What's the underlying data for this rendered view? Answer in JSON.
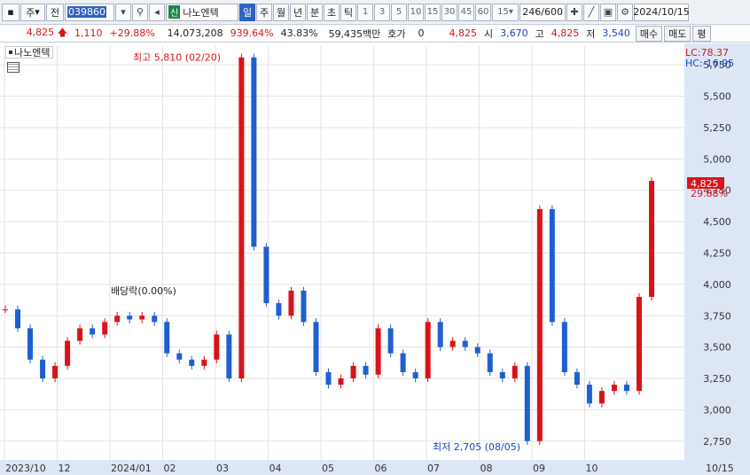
{
  "toolbar": {
    "market": "주",
    "view": "전",
    "code": "039860",
    "stock_badge": "신",
    "stock_name": "나노엔텍",
    "periods": [
      "일",
      "주",
      "월",
      "년",
      "분",
      "초",
      "틱"
    ],
    "active_period": "일",
    "intervals": [
      "1",
      "3",
      "5",
      "10",
      "15",
      "30",
      "45",
      "60"
    ],
    "interval_select": "15",
    "count": "246",
    "count_max": "/600",
    "date": "2024/10/15"
  },
  "quote": {
    "price": "4,825",
    "change": "1,110",
    "change_pct": "+29.88%",
    "volume": "14,073,208",
    "volume_ratio": "939.64%",
    "turnover": "43.83%",
    "amount": "59,435백만",
    "hoga_label": "호가",
    "hoga_value": "0",
    "hoga_price": "4,825",
    "open_label": "시",
    "open": "3,670",
    "high_label": "고",
    "high": "4,825",
    "low_label": "저",
    "low": "3,540",
    "buy_label": "매수",
    "sell_label": "매도",
    "eval_label": "평"
  },
  "legend": {
    "name": "나노엔텍"
  },
  "side": {
    "lc": "LC:78.37",
    "hc": "HC:-16.95",
    "last_price": "4,825",
    "last_pct": "29.88%"
  },
  "colors": {
    "up": "#d8141a",
    "down": "#1f5fd0",
    "axis_bg": "#dde6f4",
    "grid": "#e3e3e3"
  },
  "chart_data": {
    "type": "candlestick",
    "ylim": [
      2600,
      5900
    ],
    "y_ticks": [
      2750,
      3000,
      3250,
      3500,
      3750,
      4000,
      4250,
      4500,
      4750,
      5000,
      5250,
      5500,
      5750
    ],
    "y_tick_labels": [
      "2,750",
      "3,000",
      "3,250",
      "3,500",
      "3,750",
      "4,000",
      "4,250",
      "4,500",
      "4,750",
      "5,000",
      "5,250",
      "5,500",
      "5,750"
    ],
    "x_labels": [
      "2023/10",
      "12",
      "2024/01",
      "02",
      "03",
      "04",
      "05",
      "06",
      "07",
      "08",
      "09",
      "10",
      "10/15"
    ],
    "annotations": [
      {
        "text": "최고 5,810 (02/20)",
        "value": 5810,
        "color": "#d8141a"
      },
      {
        "text": "최저 2,705 (08/05)",
        "value": 2705,
        "color": "#1844c8"
      },
      {
        "text": "배당락(0.00%)",
        "value": 3780,
        "color": "#222222"
      }
    ],
    "series_closes": [
      3800,
      3650,
      3400,
      3250,
      3350,
      3550,
      3650,
      3600,
      3700,
      3750,
      3720,
      3750,
      3700,
      3450,
      3400,
      3350,
      3400,
      3600,
      3250,
      5810,
      4300,
      3850,
      3750,
      3950,
      3700,
      3300,
      3200,
      3250,
      3350,
      3280,
      3650,
      3450,
      3300,
      3250,
      3700,
      3500,
      3550,
      3500,
      3450,
      3300,
      3250,
      3350,
      2750,
      4600,
      3700,
      3300,
      3200,
      3050,
      3150,
      3200,
      3150,
      3900,
      4825
    ]
  }
}
